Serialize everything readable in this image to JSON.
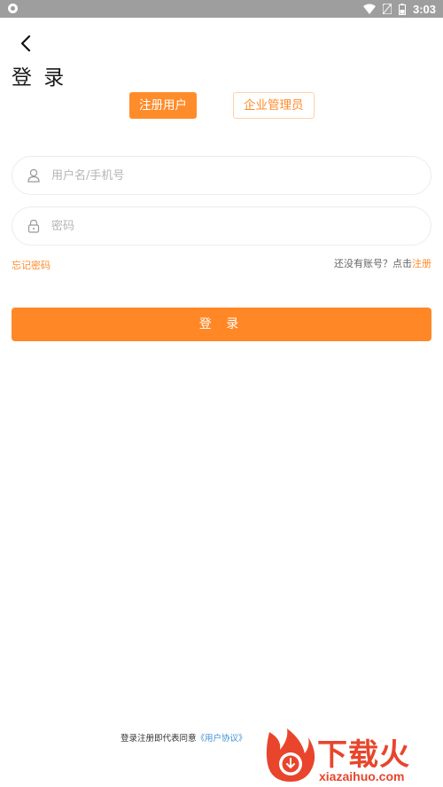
{
  "status_bar": {
    "time": "3:03",
    "icons": [
      "notification-icon",
      "wifi-icon",
      "sim-icon",
      "battery-icon"
    ],
    "background": "#9e9e9e"
  },
  "header": {
    "back_icon": "chevron-left-icon",
    "title": "登 录"
  },
  "role_tabs": [
    {
      "label": "注册用户",
      "active": true
    },
    {
      "label": "企业管理员",
      "active": false
    }
  ],
  "form": {
    "username": {
      "icon": "user-icon",
      "placeholder": "用户名/手机号",
      "value": ""
    },
    "password": {
      "icon": "lock-icon",
      "placeholder": "密码",
      "value": ""
    },
    "forgot_label": "忘记密码",
    "no_account_text": "还没有账号？点击",
    "register_label": "注册",
    "submit_label": "登 录"
  },
  "footer": {
    "agreement_text": "登录注册即代表同意",
    "agreement_link": "《用户协议》",
    "agreement_tail": "》"
  },
  "watermark": {
    "brand": "下载火",
    "url": "xiazaihuo.com"
  },
  "colors": {
    "accent": "#ff8c2b",
    "link": "#3a8fd8",
    "watermark": "#e8452c"
  }
}
